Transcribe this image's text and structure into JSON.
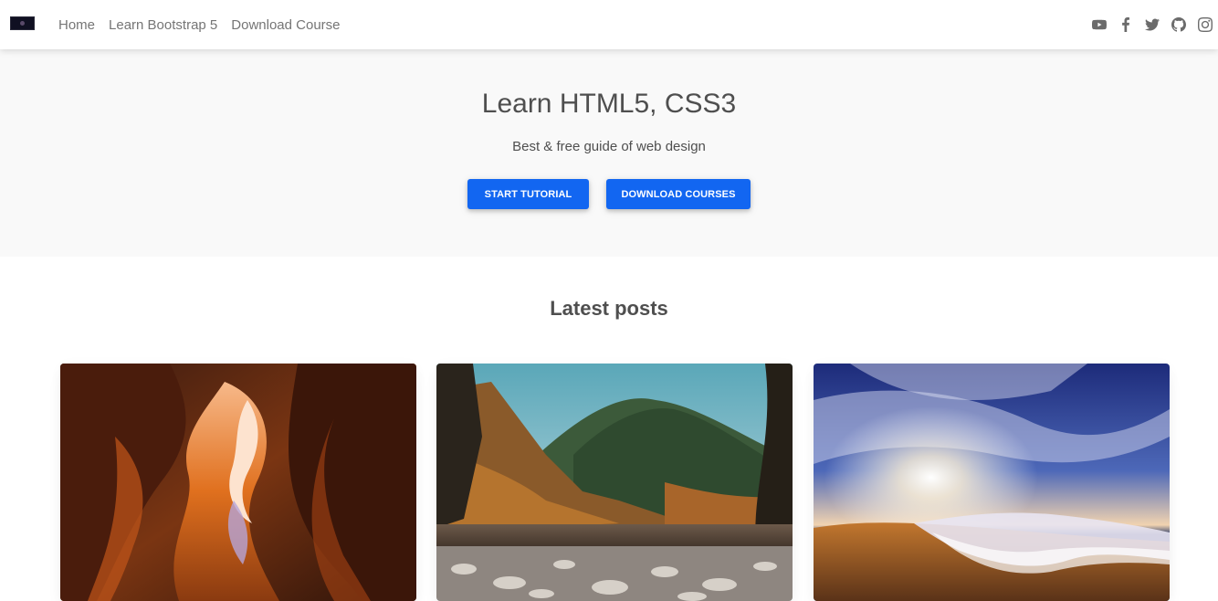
{
  "navbar": {
    "brand_icon": "brand-logo",
    "links": [
      {
        "label": "Home"
      },
      {
        "label": "Learn Bootstrap 5"
      },
      {
        "label": "Download Course"
      }
    ],
    "social_icons": [
      "youtube-icon",
      "facebook-icon",
      "twitter-icon",
      "github-icon",
      "instagram-icon"
    ]
  },
  "hero": {
    "title": "Learn HTML5, CSS3",
    "subtitle": "Best & free guide of web design",
    "buttons": {
      "start_label": "START TUTORIAL",
      "download_label": "DOWNLOAD COURSES"
    }
  },
  "latest_posts": {
    "title": "Latest posts",
    "cards": [
      {
        "image": "canyon-photo"
      },
      {
        "image": "forest-river-photo"
      },
      {
        "image": "beach-sunset-photo"
      }
    ]
  },
  "colors": {
    "primary": "#1266f1",
    "hero_bg": "#f9f9f9",
    "text": "#4f4f4f",
    "nav_link": "#757575"
  }
}
